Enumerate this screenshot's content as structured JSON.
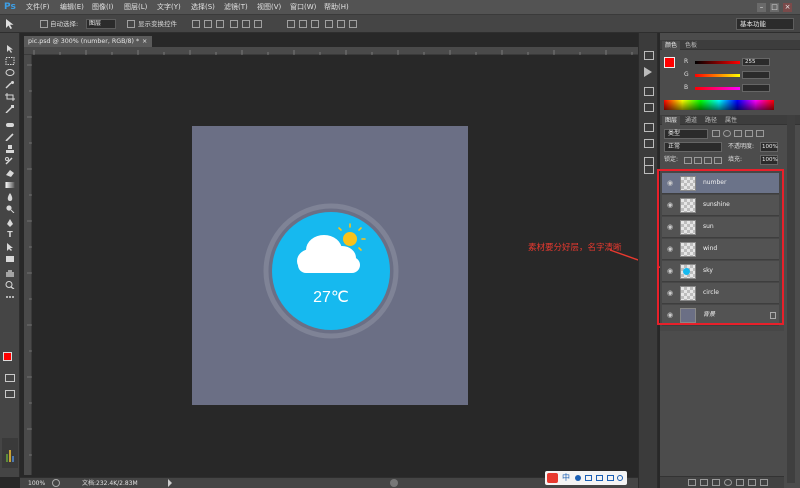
{
  "app": {
    "logo": "Ps"
  },
  "menubar": {
    "items": [
      "文件(F)",
      "编辑(E)",
      "图像(I)",
      "图层(L)",
      "文字(Y)",
      "选择(S)",
      "滤镜(T)",
      "视图(V)",
      "窗口(W)",
      "帮助(H)"
    ],
    "window_buttons": [
      "–",
      "□",
      "×"
    ]
  },
  "options_bar": {
    "auto_select_label": "自动选择:",
    "auto_select_value": "图层",
    "show_transform_label": "显示变换控件",
    "workspace": "基本功能"
  },
  "document": {
    "tab_title": "pic.psd @ 300% (number, RGB/8) *",
    "close_glyph": "×",
    "temperature": "27℃",
    "canvas_color": "#6b6f85"
  },
  "status": {
    "zoom": "100%",
    "doc_info": "文档:232.4K/2.83M"
  },
  "annotation": {
    "text": "素材要分好层，名字清晰",
    "color": "#e8392f"
  },
  "color_panel": {
    "tabs": [
      "颜色",
      "色板"
    ],
    "channels": [
      {
        "label": "R",
        "value": "255"
      },
      {
        "label": "G",
        "value": ""
      },
      {
        "label": "B",
        "value": ""
      }
    ],
    "foreground": "#ff0000"
  },
  "layers_panel": {
    "tabs": [
      "图层",
      "通道",
      "路径",
      "属性"
    ],
    "filter_kind": "类型",
    "blend_mode": "正常",
    "opacity_label": "不透明度:",
    "opacity_value": "100%",
    "lock_label": "锁定:",
    "fill_label": "填充:",
    "fill_value": "100%",
    "layers": [
      {
        "name": "number",
        "selected": true
      },
      {
        "name": "sunshine",
        "selected": false
      },
      {
        "name": "sun",
        "selected": false
      },
      {
        "name": "wind",
        "selected": false
      },
      {
        "name": "sky",
        "selected": false
      },
      {
        "name": "circle",
        "selected": false
      },
      {
        "name": "背景",
        "selected": false
      }
    ]
  },
  "watermark": {
    "ime_label": "中"
  }
}
